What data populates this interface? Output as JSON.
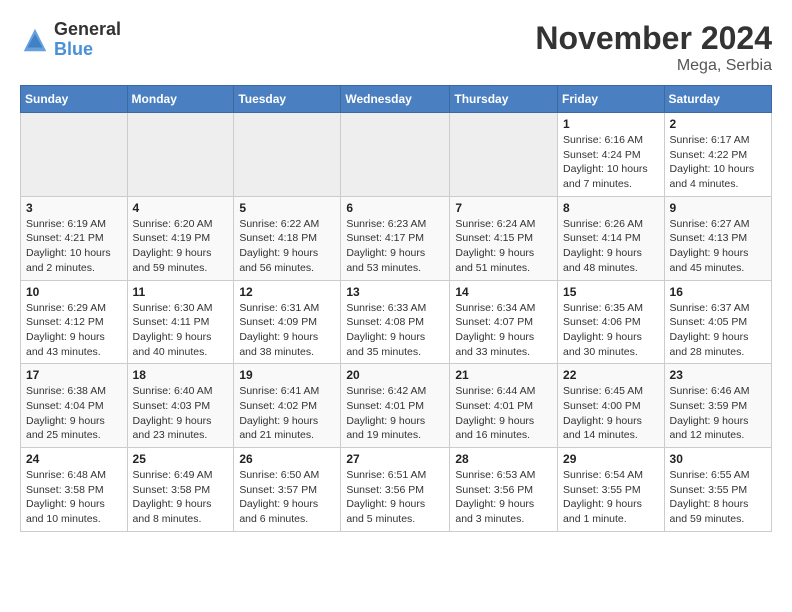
{
  "header": {
    "logo_general": "General",
    "logo_blue": "Blue",
    "month_title": "November 2024",
    "location": "Mega, Serbia"
  },
  "weekdays": [
    "Sunday",
    "Monday",
    "Tuesday",
    "Wednesday",
    "Thursday",
    "Friday",
    "Saturday"
  ],
  "weeks": [
    [
      {
        "day": "",
        "info": ""
      },
      {
        "day": "",
        "info": ""
      },
      {
        "day": "",
        "info": ""
      },
      {
        "day": "",
        "info": ""
      },
      {
        "day": "",
        "info": ""
      },
      {
        "day": "1",
        "info": "Sunrise: 6:16 AM\nSunset: 4:24 PM\nDaylight: 10 hours\nand 7 minutes."
      },
      {
        "day": "2",
        "info": "Sunrise: 6:17 AM\nSunset: 4:22 PM\nDaylight: 10 hours\nand 4 minutes."
      }
    ],
    [
      {
        "day": "3",
        "info": "Sunrise: 6:19 AM\nSunset: 4:21 PM\nDaylight: 10 hours\nand 2 minutes."
      },
      {
        "day": "4",
        "info": "Sunrise: 6:20 AM\nSunset: 4:19 PM\nDaylight: 9 hours\nand 59 minutes."
      },
      {
        "day": "5",
        "info": "Sunrise: 6:22 AM\nSunset: 4:18 PM\nDaylight: 9 hours\nand 56 minutes."
      },
      {
        "day": "6",
        "info": "Sunrise: 6:23 AM\nSunset: 4:17 PM\nDaylight: 9 hours\nand 53 minutes."
      },
      {
        "day": "7",
        "info": "Sunrise: 6:24 AM\nSunset: 4:15 PM\nDaylight: 9 hours\nand 51 minutes."
      },
      {
        "day": "8",
        "info": "Sunrise: 6:26 AM\nSunset: 4:14 PM\nDaylight: 9 hours\nand 48 minutes."
      },
      {
        "day": "9",
        "info": "Sunrise: 6:27 AM\nSunset: 4:13 PM\nDaylight: 9 hours\nand 45 minutes."
      }
    ],
    [
      {
        "day": "10",
        "info": "Sunrise: 6:29 AM\nSunset: 4:12 PM\nDaylight: 9 hours\nand 43 minutes."
      },
      {
        "day": "11",
        "info": "Sunrise: 6:30 AM\nSunset: 4:11 PM\nDaylight: 9 hours\nand 40 minutes."
      },
      {
        "day": "12",
        "info": "Sunrise: 6:31 AM\nSunset: 4:09 PM\nDaylight: 9 hours\nand 38 minutes."
      },
      {
        "day": "13",
        "info": "Sunrise: 6:33 AM\nSunset: 4:08 PM\nDaylight: 9 hours\nand 35 minutes."
      },
      {
        "day": "14",
        "info": "Sunrise: 6:34 AM\nSunset: 4:07 PM\nDaylight: 9 hours\nand 33 minutes."
      },
      {
        "day": "15",
        "info": "Sunrise: 6:35 AM\nSunset: 4:06 PM\nDaylight: 9 hours\nand 30 minutes."
      },
      {
        "day": "16",
        "info": "Sunrise: 6:37 AM\nSunset: 4:05 PM\nDaylight: 9 hours\nand 28 minutes."
      }
    ],
    [
      {
        "day": "17",
        "info": "Sunrise: 6:38 AM\nSunset: 4:04 PM\nDaylight: 9 hours\nand 25 minutes."
      },
      {
        "day": "18",
        "info": "Sunrise: 6:40 AM\nSunset: 4:03 PM\nDaylight: 9 hours\nand 23 minutes."
      },
      {
        "day": "19",
        "info": "Sunrise: 6:41 AM\nSunset: 4:02 PM\nDaylight: 9 hours\nand 21 minutes."
      },
      {
        "day": "20",
        "info": "Sunrise: 6:42 AM\nSunset: 4:01 PM\nDaylight: 9 hours\nand 19 minutes."
      },
      {
        "day": "21",
        "info": "Sunrise: 6:44 AM\nSunset: 4:01 PM\nDaylight: 9 hours\nand 16 minutes."
      },
      {
        "day": "22",
        "info": "Sunrise: 6:45 AM\nSunset: 4:00 PM\nDaylight: 9 hours\nand 14 minutes."
      },
      {
        "day": "23",
        "info": "Sunrise: 6:46 AM\nSunset: 3:59 PM\nDaylight: 9 hours\nand 12 minutes."
      }
    ],
    [
      {
        "day": "24",
        "info": "Sunrise: 6:48 AM\nSunset: 3:58 PM\nDaylight: 9 hours\nand 10 minutes."
      },
      {
        "day": "25",
        "info": "Sunrise: 6:49 AM\nSunset: 3:58 PM\nDaylight: 9 hours\nand 8 minutes."
      },
      {
        "day": "26",
        "info": "Sunrise: 6:50 AM\nSunset: 3:57 PM\nDaylight: 9 hours\nand 6 minutes."
      },
      {
        "day": "27",
        "info": "Sunrise: 6:51 AM\nSunset: 3:56 PM\nDaylight: 9 hours\nand 5 minutes."
      },
      {
        "day": "28",
        "info": "Sunrise: 6:53 AM\nSunset: 3:56 PM\nDaylight: 9 hours\nand 3 minutes."
      },
      {
        "day": "29",
        "info": "Sunrise: 6:54 AM\nSunset: 3:55 PM\nDaylight: 9 hours\nand 1 minute."
      },
      {
        "day": "30",
        "info": "Sunrise: 6:55 AM\nSunset: 3:55 PM\nDaylight: 8 hours\nand 59 minutes."
      }
    ]
  ]
}
